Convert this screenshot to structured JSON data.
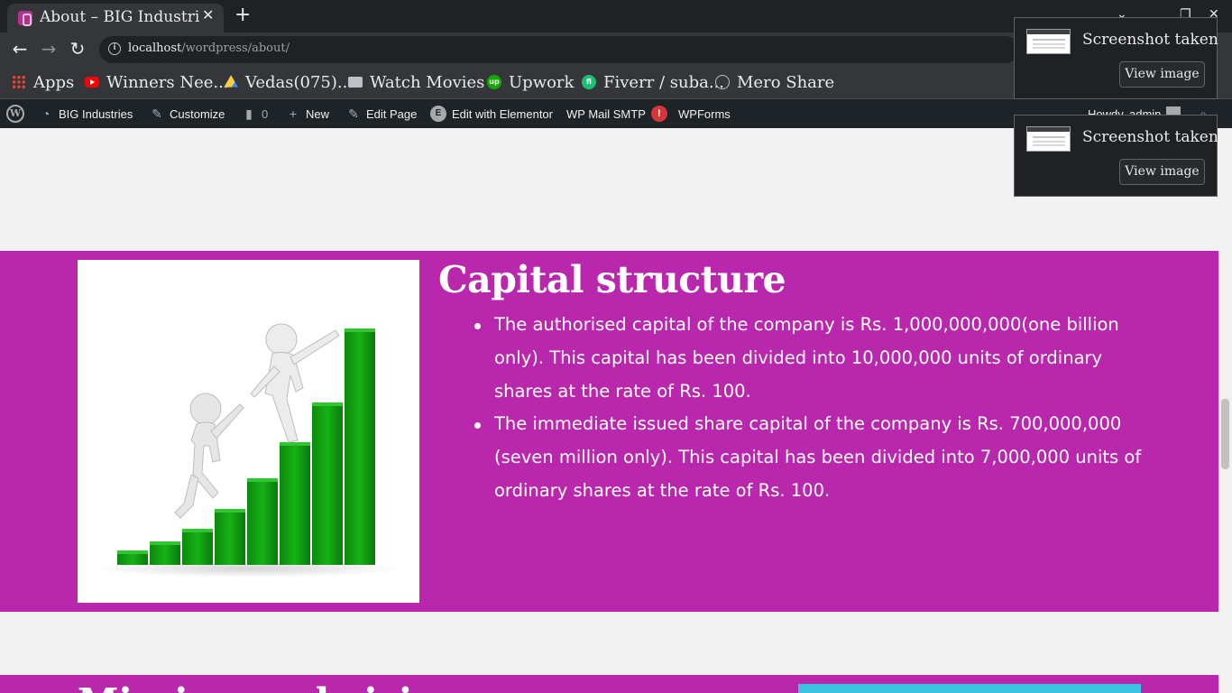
{
  "browser": {
    "tab_title": "About – BIG Industries",
    "url_host": "localhost",
    "url_path": "/wordpress/about/",
    "bookmarks": [
      {
        "label": "Apps",
        "icon": "apps-grid-icon"
      },
      {
        "label": "Winners Nee...",
        "icon": "youtube-icon"
      },
      {
        "label": "Vedas(075)...",
        "icon": "google-drive-icon"
      },
      {
        "label": "Watch Movies",
        "icon": "folder-icon"
      },
      {
        "label": "Upwork",
        "icon": "upwork-icon"
      },
      {
        "label": "Fiverr / suba...",
        "icon": "fiverr-icon"
      },
      {
        "label": "Mero Share",
        "icon": "mero-share-icon"
      }
    ]
  },
  "adminbar": {
    "site_name": "BIG Industries",
    "customize": "Customize",
    "comments_count": "0",
    "new": "New",
    "edit_page": "Edit Page",
    "edit_elementor": "Edit with Elementor",
    "wp_mail_smtp": "WP Mail SMTP",
    "wp_mail_badge": "!",
    "wpforms": "WPForms",
    "howdy": "Howdy, admin"
  },
  "capital_section": {
    "title": "Capital structure",
    "bullets": [
      "The authorised capital of the company is Rs. 1,000,000,000(one billion only). This capital has been divided into 10,000,000 units of ordinary shares at the rate of Rs. 100.",
      "The immediate issued share capital of the company is Rs. 700,000,000 (seven million only). This capital has been divided into 7,000,000 units of ordinary shares at the rate of Rs. 100."
    ],
    "image": "growth-chart-climbers-illustration",
    "accent_color": "#b927ac",
    "bar_color": "#0a9e0a"
  },
  "mission_section": {
    "title_partial": "Mission and vision"
  },
  "toasts": [
    {
      "title": "Screenshot taken",
      "button": "View image"
    },
    {
      "title": "Screenshot taken",
      "button": "View image"
    }
  ]
}
